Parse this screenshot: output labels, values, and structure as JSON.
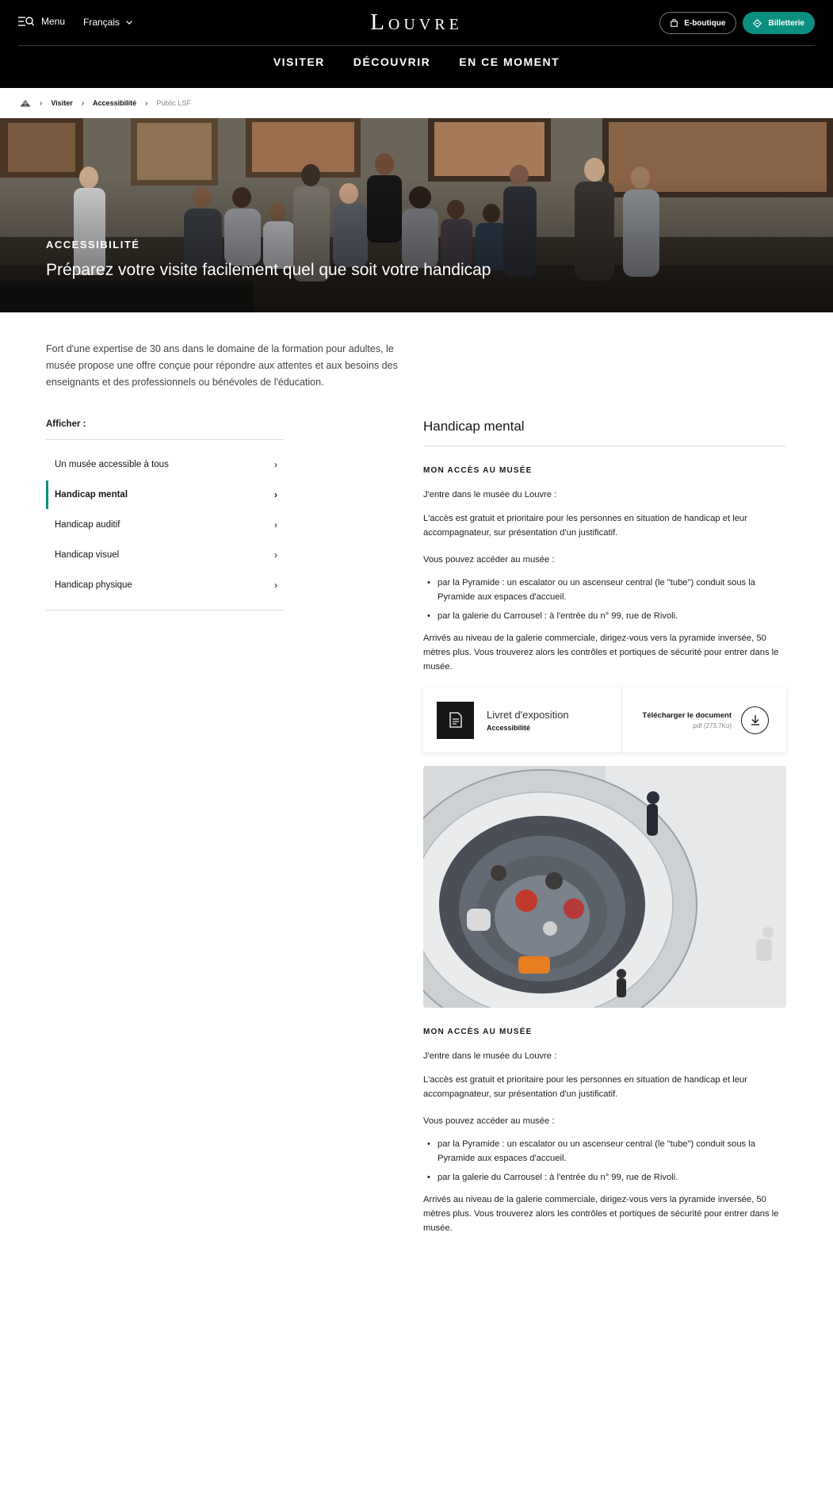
{
  "header": {
    "menu_label": "Menu",
    "language": "Français",
    "logo": "Louvre",
    "eboutique_label": "E-boutique",
    "billetterie_label": "Billetterie",
    "accent_color": "#0b8f80",
    "nav": [
      "VISITER",
      "DÉCOUVRIR",
      "EN CE MOMENT"
    ]
  },
  "breadcrumb": {
    "home_icon": "pyramid-icon",
    "items": [
      "Visiter",
      "Accessibilité",
      "Public LSF"
    ]
  },
  "hero": {
    "kicker": "ACCESSIBILITÉ",
    "title": "Préparez votre visite facilement quel que soit votre handicap"
  },
  "intro": "Fort d'une expertise de 30 ans dans le domaine de la formation pour adultes, le musée propose une offre conçue pour répondre aux attentes et aux besoins des enseignants et des professionnels ou bénévoles de l'éducation.",
  "sidebar": {
    "heading": "Afficher :",
    "items": [
      {
        "label": "Un musée accessible à tous"
      },
      {
        "label": "Handicap mental"
      },
      {
        "label": "Handicap auditif"
      },
      {
        "label": "Handicap visuel"
      },
      {
        "label": "Handicap physique"
      }
    ],
    "active_index": 1
  },
  "main": {
    "title": "Handicap mental",
    "sections": [
      {
        "heading": "MON ACCÈS AU MUSÉE",
        "p1": "J'entre dans le musée du Louvre :",
        "p2": "L'accès est gratuit et prioritaire pour les personnes en situation de handicap et leur accompagnateur, sur présentation d'un justificatif.",
        "p3": "Vous pouvez accéder au musée :",
        "bullets": [
          "par la Pyramide : un escalator ou un ascenseur central (le \"tube\") conduit sous la Pyramide aux espaces d'accueil.",
          "par la galerie du Carrousel : à l'entrée du n° 99, rue de Rivoli."
        ],
        "p4": "Arrivés au niveau de la galerie commerciale, dirigez-vous vers la pyramide inversée, 50 mètres plus. Vous trouverez alors les contrôles et portiques de sécurité pour entrer dans le musée."
      },
      {
        "heading": "MON ACCÈS AU MUSÉE",
        "p1": "J'entre dans le musée du Louvre :",
        "p2": "L'accès est gratuit et prioritaire pour les personnes en situation de handicap et leur accompagnateur, sur présentation d'un justificatif.",
        "p3": "Vous pouvez accéder au musée :",
        "bullets": [
          "par la Pyramide : un escalator ou un ascenseur central (le \"tube\") conduit sous la Pyramide aux espaces d'accueil.",
          "par la galerie du Carrousel : à l'entrée du n° 99, rue de Rivoli."
        ],
        "p4": "Arrivés au niveau de la galerie commerciale, dirigez-vous vers la pyramide inversée, 50 mètres plus. Vous trouverez alors les contrôles et portiques de sécurité pour entrer dans le musée."
      }
    ],
    "document": {
      "name": "Livret d'exposition",
      "category": "Accessibilité",
      "download_label": "Télécharger le document",
      "size": ".pdf (273,7Ko)"
    }
  }
}
